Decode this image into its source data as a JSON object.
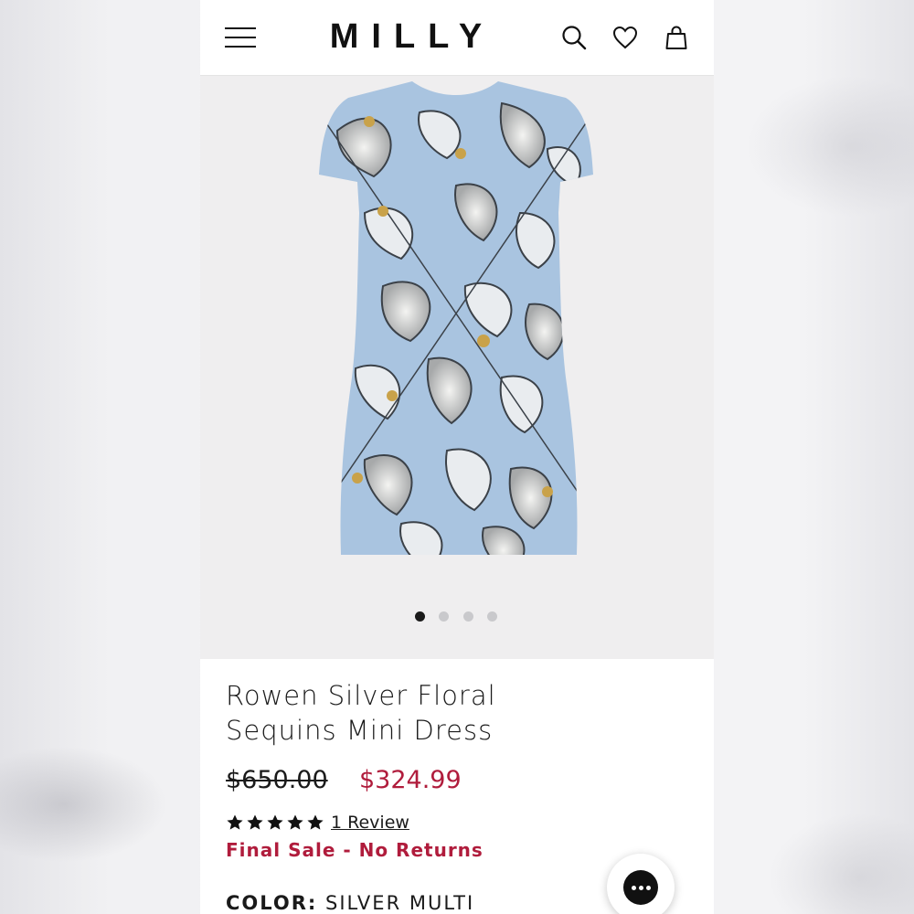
{
  "header": {
    "brand": "MILLY",
    "icons": [
      "menu-icon",
      "search-icon",
      "heart-icon",
      "bag-icon"
    ]
  },
  "gallery": {
    "image_count": 4,
    "active_index": 0
  },
  "product": {
    "title_line1": "Rowen Silver Floral",
    "title_line2": "Sequins Mini Dress",
    "price_original": "$650.00",
    "price_sale": "$324.99",
    "rating": 5,
    "reviews_label": "1 Review",
    "final_sale": "Final Sale - No Returns",
    "color_label": "COLOR:",
    "color_value": "SILVER MULTI"
  },
  "colors": {
    "sale": "#b01c3c",
    "text": "#1a1a1a",
    "dress_base": "#a9c4e0"
  },
  "chat": {
    "icon": "chat-bubble-icon"
  }
}
